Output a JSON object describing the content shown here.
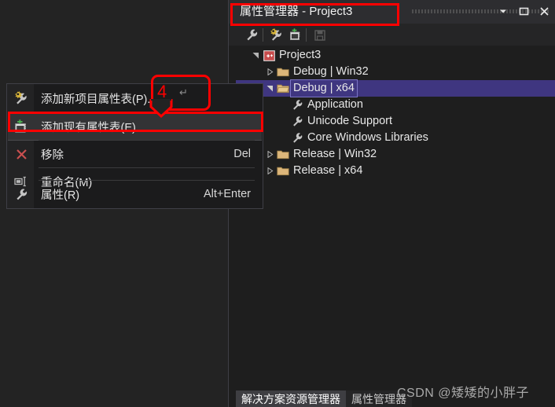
{
  "window": {
    "title": "属性管理器 - Project3",
    "controls": [
      {
        "name": "dropdown",
        "glyph": "chevron-down"
      },
      {
        "name": "maximize",
        "glyph": "square"
      },
      {
        "name": "close",
        "glyph": "x"
      }
    ]
  },
  "toolbar": {
    "items": [
      {
        "name": "properties-wrench",
        "icon": "wrench-icon",
        "enabled": true
      },
      {
        "name": "project-properties-wrench",
        "icon": "gear-wrench-icon",
        "enabled": true
      },
      {
        "name": "add-new-project-property-sheet",
        "icon": "add-property-sheet-icon",
        "enabled": true
      },
      {
        "name": "save",
        "icon": "save-icon",
        "enabled": false
      }
    ]
  },
  "tree": {
    "nodes": [
      {
        "label": "Project3",
        "indent": 0,
        "twist": "expanded",
        "icon": "cpp-project-icon",
        "selected": false
      },
      {
        "label": "Debug | Win32",
        "indent": 1,
        "twist": "collapsed",
        "icon": "folder-icon",
        "selected": false
      },
      {
        "label": "Debug | x64",
        "indent": 1,
        "twist": "expanded",
        "icon": "folder-open-icon",
        "selected": true
      },
      {
        "label": "Application",
        "indent": 2,
        "twist": "none",
        "icon": "wrench-icon",
        "selected": false
      },
      {
        "label": "Unicode Support",
        "indent": 2,
        "twist": "none",
        "icon": "wrench-icon",
        "selected": false
      },
      {
        "label": "Core Windows Libraries",
        "indent": 2,
        "twist": "none",
        "icon": "wrench-icon",
        "selected": false
      },
      {
        "label": "Release | Win32",
        "indent": 1,
        "twist": "collapsed",
        "icon": "folder-icon",
        "selected": false
      },
      {
        "label": "Release | x64",
        "indent": 1,
        "twist": "collapsed",
        "icon": "folder-icon",
        "selected": false
      }
    ]
  },
  "context_menu": {
    "items": [
      {
        "label": "添加新项目属性表(P)...",
        "shortcut": "",
        "icon": "gear-wrench-icon",
        "highlighted": false
      },
      {
        "label": "添加现有属性表(E)...",
        "shortcut": "",
        "icon": "add-property-sheet-icon",
        "highlighted": true
      },
      {
        "label": "移除",
        "shortcut": "Del",
        "icon": "x-remove-icon",
        "highlighted": false
      },
      {
        "label": "重命名(M)",
        "shortcut": "",
        "icon": "rename-icon",
        "highlighted": false
      },
      {
        "label": "属性(R)",
        "shortcut": "Alt+Enter",
        "icon": "wrench-icon",
        "highlighted": false
      }
    ]
  },
  "bottom_tabs": [
    {
      "label": "解决方案资源管理器",
      "active": true
    },
    {
      "label": "属性管理器",
      "active": false
    }
  ],
  "annotations": {
    "callout_number": "4",
    "callout_return_glyph": "↵",
    "highlight_color": "#ff0000"
  },
  "watermark": {
    "text": "CSDN @矮矮的小胖子"
  }
}
